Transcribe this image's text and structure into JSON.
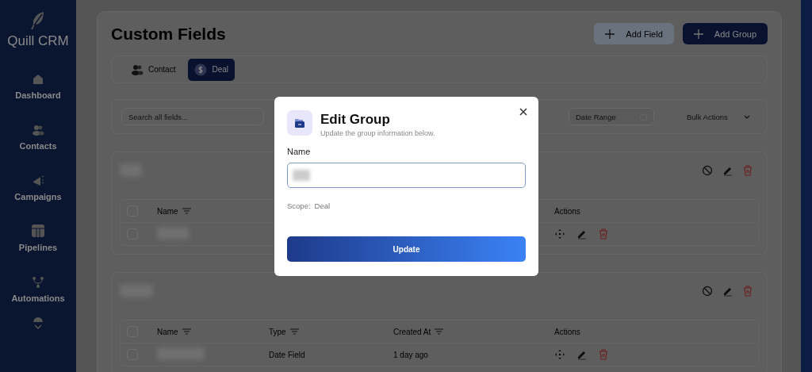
{
  "sidebar": {
    "brand": "Quill CRM",
    "items": [
      {
        "label": "Dashboard"
      },
      {
        "label": "Contacts"
      },
      {
        "label": "Campaigns"
      },
      {
        "label": "Pipelines"
      },
      {
        "label": "Automations"
      }
    ]
  },
  "page": {
    "title": "Custom Fields",
    "buttons": [
      {
        "label": "Add Field",
        "kind": "secondary"
      },
      {
        "label": "Add Group",
        "kind": "primary"
      }
    ],
    "tabs": [
      {
        "label": "Contact",
        "selected": false
      },
      {
        "label": "Deal",
        "selected": true
      }
    ],
    "filters": {
      "search": {
        "placeholder": "Search all fields..."
      },
      "date_range": {
        "placeholder": "Date Range"
      },
      "bulk_actions": {
        "label": "Bulk Actions"
      }
    },
    "groups": [
      {
        "all_checked": false,
        "columns": [
          {
            "label": "Name",
            "kind": "text",
            "filter": true
          },
          {
            "label": "Actions",
            "kind": "actions",
            "filter": false
          }
        ],
        "rows": [
          {
            "checked": false,
            "cells": [
              {
                "kind": "blurred"
              },
              {
                "kind": "actions"
              }
            ]
          }
        ]
      },
      {
        "all_checked": false,
        "columns": [
          {
            "label": "Name",
            "kind": "text",
            "filter": true
          },
          {
            "label": "Type",
            "kind": "text",
            "filter": true
          },
          {
            "label": "Created At",
            "kind": "text",
            "filter": true
          },
          {
            "label": "Actions",
            "kind": "actions",
            "filter": false
          }
        ],
        "rows": [
          {
            "checked": false,
            "cells": [
              {
                "kind": "blurred"
              },
              {
                "kind": "text",
                "text": "Date Field"
              },
              {
                "kind": "text",
                "text": "1 day ago"
              },
              {
                "kind": "actions"
              }
            ]
          }
        ]
      }
    ]
  },
  "modal": {
    "title": "Edit Group",
    "subtitle": "Update the group information below.",
    "field_label": "Name",
    "scope_label": "Scope:",
    "scope_value": "Deal",
    "submit": "Update"
  }
}
